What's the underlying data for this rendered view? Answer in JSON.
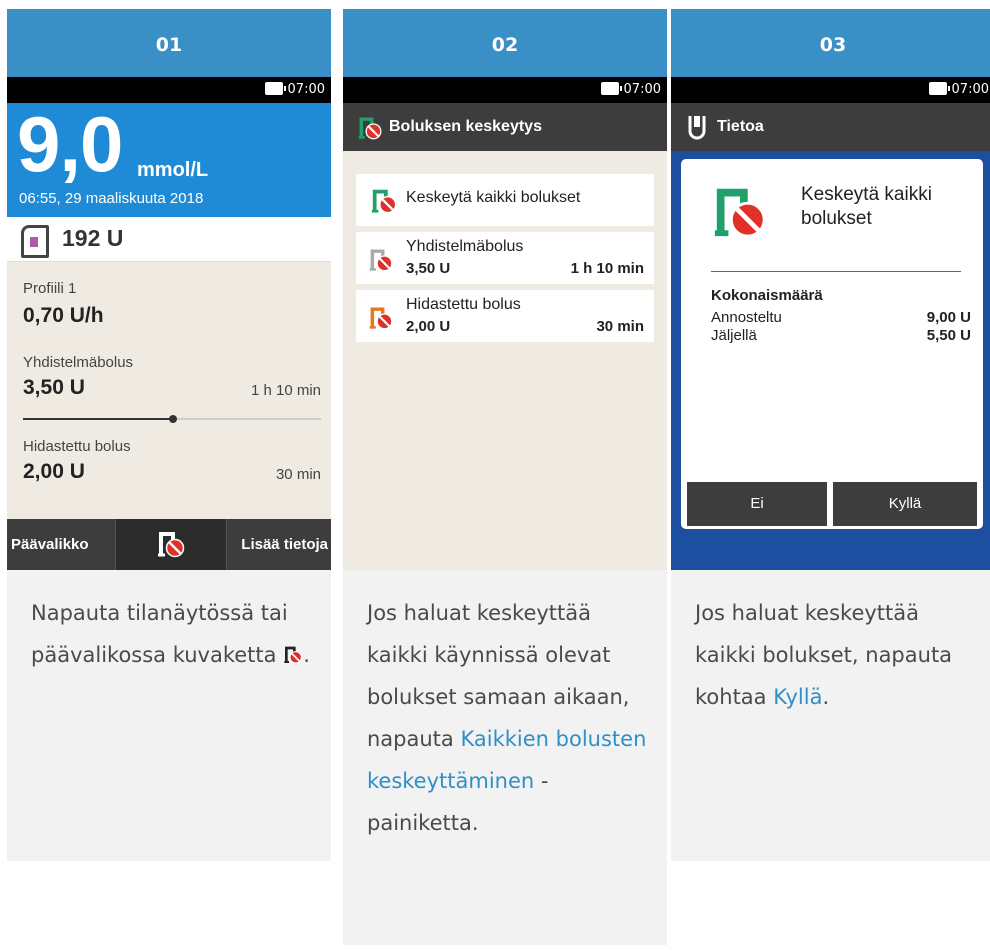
{
  "steps": [
    "01",
    "02",
    "03"
  ],
  "status_time": "07:00",
  "screen1": {
    "bg_value": "9,0",
    "bg_unit": "mmol/L",
    "bg_time": "06:55, 29 maaliskuuta 2018",
    "reservoir": "192 U",
    "profile_label": "Profiili 1",
    "basal_rate": "0,70 U/h",
    "bolus1_label": "Yhdistelmäbolus",
    "bolus1_amount": "3,50 U",
    "bolus1_duration": "1 h 10 min",
    "bolus2_label": "Hidastettu bolus",
    "bolus2_amount": "2,00 U",
    "bolus2_duration": "30 min",
    "menu_label": "Päävalikko",
    "more_label": "Lisää tietoja"
  },
  "screen2": {
    "title": "Boluksen keskeytys",
    "stop_all_label": "Keskeytä kaikki bolukset",
    "items": [
      {
        "name": "Yhdistelmäbolus",
        "amount": "3,50 U",
        "duration": "1 h 10 min"
      },
      {
        "name": "Hidastettu bolus",
        "amount": "2,00 U",
        "duration": "30 min"
      }
    ]
  },
  "screen3": {
    "title": "Tietoa",
    "dialog_title": "Keskeytä kaikki bolukset",
    "total_heading": "Kokonaismäärä",
    "delivered_label": "Annosteltu",
    "delivered_value": "9,00 U",
    "remaining_label": "Jäljellä",
    "remaining_value": "5,50 U",
    "no_label": "Ei",
    "yes_label": "Kyllä"
  },
  "captions": {
    "c1_text": "Napauta tilanäytössä tai päävalikossa kuvaketta",
    "c1_end": ".",
    "c2_text": "Jos haluat keskeyttää kaikki käynnissä olevat bolukset samaan aikaan, napauta",
    "c2_link": "Kaikkien bolusten keskeyttäminen",
    "c2_end": "- painiketta.",
    "c3_text": "Jos haluat keskeyttää kaikki bolukset, napauta kohtaa",
    "c3_link": "Kyllä",
    "c3_end": "."
  },
  "colors": {
    "header": "#3a8fc6",
    "bg_panel": "#1f8ad6",
    "link": "#2f8fc7",
    "stop_green": "#22a06b",
    "stop_red": "#e0302a"
  }
}
